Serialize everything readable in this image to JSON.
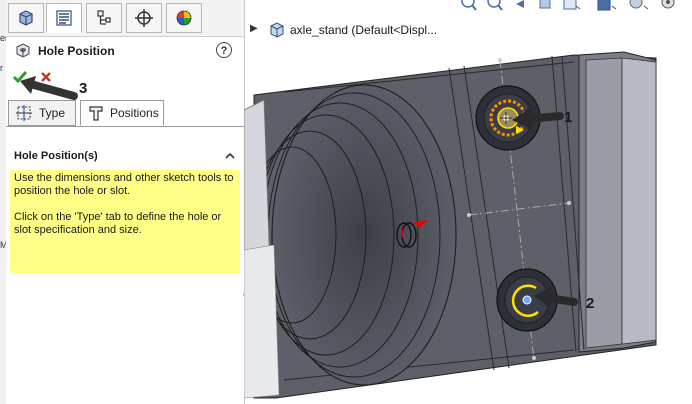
{
  "left_edge": {
    "lines": [
      "er",
      "r",
      "M"
    ]
  },
  "manager_tabs": [
    {
      "name": "featuremanager-tab"
    },
    {
      "name": "propertymanager-tab"
    },
    {
      "name": "configurationmanager-tab"
    },
    {
      "name": "dimxpertmanager-tab"
    },
    {
      "name": "displaymanager-tab"
    }
  ],
  "property_manager": {
    "title": "Hole Position",
    "help_icon": "help-icon",
    "ok_icon": "checkmark-icon",
    "cancel_icon": "cancel-x-icon",
    "tabs": [
      {
        "label": "Type",
        "icon": "hole-type-icon"
      },
      {
        "label": "Positions",
        "icon": "hole-positions-icon"
      }
    ],
    "section": {
      "title": "Hole Position(s)",
      "message_1": "Use the dimensions and other sketch tools to position the hole or slot.",
      "message_2": "Click on the 'Type' tab to define the hole or slot specification and size."
    }
  },
  "breadcrumb": {
    "part_name": "axle_stand  (Default<Displ..."
  },
  "annotations": {
    "step_1": "1",
    "step_2": "2",
    "step_3": "3"
  },
  "colors": {
    "info_background": "#ffff88",
    "ok_green": "#2a9d2a",
    "cancel_red": "#c0392b",
    "model_dark": "#5d6068",
    "model_light": "#8c8f9a",
    "sketch_orange": "#ff8c00",
    "sketch_yellow": "#ffe000"
  }
}
